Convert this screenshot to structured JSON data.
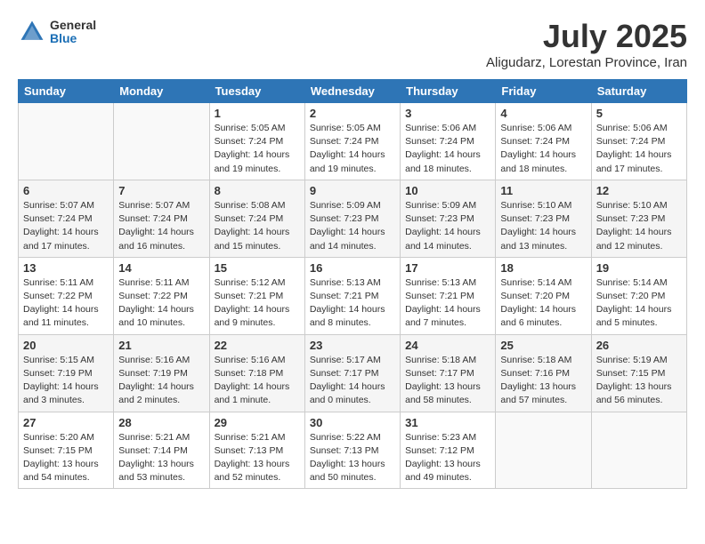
{
  "header": {
    "logo_general": "General",
    "logo_blue": "Blue",
    "month_title": "July 2025",
    "location": "Aligudarz, Lorestan Province, Iran"
  },
  "weekdays": [
    "Sunday",
    "Monday",
    "Tuesday",
    "Wednesday",
    "Thursday",
    "Friday",
    "Saturday"
  ],
  "weeks": [
    [
      {
        "day": "",
        "empty": true
      },
      {
        "day": "",
        "empty": true
      },
      {
        "day": "1",
        "sunrise": "Sunrise: 5:05 AM",
        "sunset": "Sunset: 7:24 PM",
        "daylight": "Daylight: 14 hours and 19 minutes."
      },
      {
        "day": "2",
        "sunrise": "Sunrise: 5:05 AM",
        "sunset": "Sunset: 7:24 PM",
        "daylight": "Daylight: 14 hours and 19 minutes."
      },
      {
        "day": "3",
        "sunrise": "Sunrise: 5:06 AM",
        "sunset": "Sunset: 7:24 PM",
        "daylight": "Daylight: 14 hours and 18 minutes."
      },
      {
        "day": "4",
        "sunrise": "Sunrise: 5:06 AM",
        "sunset": "Sunset: 7:24 PM",
        "daylight": "Daylight: 14 hours and 18 minutes."
      },
      {
        "day": "5",
        "sunrise": "Sunrise: 5:06 AM",
        "sunset": "Sunset: 7:24 PM",
        "daylight": "Daylight: 14 hours and 17 minutes."
      }
    ],
    [
      {
        "day": "6",
        "sunrise": "Sunrise: 5:07 AM",
        "sunset": "Sunset: 7:24 PM",
        "daylight": "Daylight: 14 hours and 17 minutes."
      },
      {
        "day": "7",
        "sunrise": "Sunrise: 5:07 AM",
        "sunset": "Sunset: 7:24 PM",
        "daylight": "Daylight: 14 hours and 16 minutes."
      },
      {
        "day": "8",
        "sunrise": "Sunrise: 5:08 AM",
        "sunset": "Sunset: 7:24 PM",
        "daylight": "Daylight: 14 hours and 15 minutes."
      },
      {
        "day": "9",
        "sunrise": "Sunrise: 5:09 AM",
        "sunset": "Sunset: 7:23 PM",
        "daylight": "Daylight: 14 hours and 14 minutes."
      },
      {
        "day": "10",
        "sunrise": "Sunrise: 5:09 AM",
        "sunset": "Sunset: 7:23 PM",
        "daylight": "Daylight: 14 hours and 14 minutes."
      },
      {
        "day": "11",
        "sunrise": "Sunrise: 5:10 AM",
        "sunset": "Sunset: 7:23 PM",
        "daylight": "Daylight: 14 hours and 13 minutes."
      },
      {
        "day": "12",
        "sunrise": "Sunrise: 5:10 AM",
        "sunset": "Sunset: 7:23 PM",
        "daylight": "Daylight: 14 hours and 12 minutes."
      }
    ],
    [
      {
        "day": "13",
        "sunrise": "Sunrise: 5:11 AM",
        "sunset": "Sunset: 7:22 PM",
        "daylight": "Daylight: 14 hours and 11 minutes."
      },
      {
        "day": "14",
        "sunrise": "Sunrise: 5:11 AM",
        "sunset": "Sunset: 7:22 PM",
        "daylight": "Daylight: 14 hours and 10 minutes."
      },
      {
        "day": "15",
        "sunrise": "Sunrise: 5:12 AM",
        "sunset": "Sunset: 7:21 PM",
        "daylight": "Daylight: 14 hours and 9 minutes."
      },
      {
        "day": "16",
        "sunrise": "Sunrise: 5:13 AM",
        "sunset": "Sunset: 7:21 PM",
        "daylight": "Daylight: 14 hours and 8 minutes."
      },
      {
        "day": "17",
        "sunrise": "Sunrise: 5:13 AM",
        "sunset": "Sunset: 7:21 PM",
        "daylight": "Daylight: 14 hours and 7 minutes."
      },
      {
        "day": "18",
        "sunrise": "Sunrise: 5:14 AM",
        "sunset": "Sunset: 7:20 PM",
        "daylight": "Daylight: 14 hours and 6 minutes."
      },
      {
        "day": "19",
        "sunrise": "Sunrise: 5:14 AM",
        "sunset": "Sunset: 7:20 PM",
        "daylight": "Daylight: 14 hours and 5 minutes."
      }
    ],
    [
      {
        "day": "20",
        "sunrise": "Sunrise: 5:15 AM",
        "sunset": "Sunset: 7:19 PM",
        "daylight": "Daylight: 14 hours and 3 minutes."
      },
      {
        "day": "21",
        "sunrise": "Sunrise: 5:16 AM",
        "sunset": "Sunset: 7:19 PM",
        "daylight": "Daylight: 14 hours and 2 minutes."
      },
      {
        "day": "22",
        "sunrise": "Sunrise: 5:16 AM",
        "sunset": "Sunset: 7:18 PM",
        "daylight": "Daylight: 14 hours and 1 minute."
      },
      {
        "day": "23",
        "sunrise": "Sunrise: 5:17 AM",
        "sunset": "Sunset: 7:17 PM",
        "daylight": "Daylight: 14 hours and 0 minutes."
      },
      {
        "day": "24",
        "sunrise": "Sunrise: 5:18 AM",
        "sunset": "Sunset: 7:17 PM",
        "daylight": "Daylight: 13 hours and 58 minutes."
      },
      {
        "day": "25",
        "sunrise": "Sunrise: 5:18 AM",
        "sunset": "Sunset: 7:16 PM",
        "daylight": "Daylight: 13 hours and 57 minutes."
      },
      {
        "day": "26",
        "sunrise": "Sunrise: 5:19 AM",
        "sunset": "Sunset: 7:15 PM",
        "daylight": "Daylight: 13 hours and 56 minutes."
      }
    ],
    [
      {
        "day": "27",
        "sunrise": "Sunrise: 5:20 AM",
        "sunset": "Sunset: 7:15 PM",
        "daylight": "Daylight: 13 hours and 54 minutes."
      },
      {
        "day": "28",
        "sunrise": "Sunrise: 5:21 AM",
        "sunset": "Sunset: 7:14 PM",
        "daylight": "Daylight: 13 hours and 53 minutes."
      },
      {
        "day": "29",
        "sunrise": "Sunrise: 5:21 AM",
        "sunset": "Sunset: 7:13 PM",
        "daylight": "Daylight: 13 hours and 52 minutes."
      },
      {
        "day": "30",
        "sunrise": "Sunrise: 5:22 AM",
        "sunset": "Sunset: 7:13 PM",
        "daylight": "Daylight: 13 hours and 50 minutes."
      },
      {
        "day": "31",
        "sunrise": "Sunrise: 5:23 AM",
        "sunset": "Sunset: 7:12 PM",
        "daylight": "Daylight: 13 hours and 49 minutes."
      },
      {
        "day": "",
        "empty": true
      },
      {
        "day": "",
        "empty": true
      }
    ]
  ]
}
